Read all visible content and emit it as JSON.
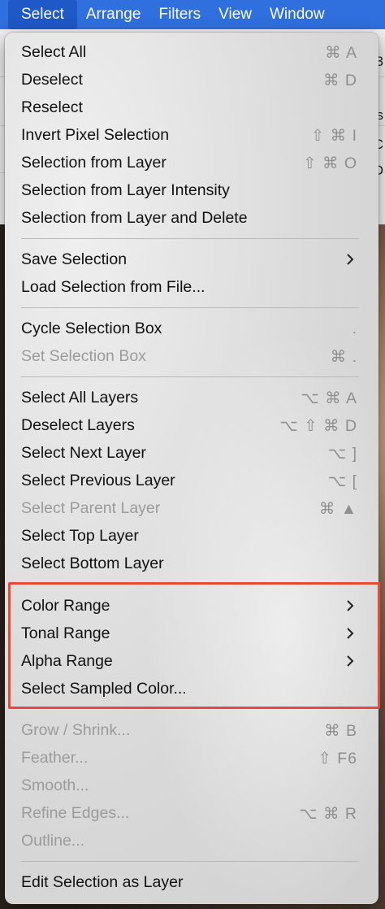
{
  "menubar": {
    "items": [
      "Select",
      "Arrange",
      "Filters",
      "View",
      "Window"
    ]
  },
  "backdrop_fragments": [
    "3",
    "s",
    "C",
    "D"
  ],
  "menu": {
    "select_all": {
      "label": "Select All",
      "shortcut": "⌘ A"
    },
    "deselect": {
      "label": "Deselect",
      "shortcut": "⌘ D"
    },
    "reselect": {
      "label": "Reselect"
    },
    "invert_pixel_selection": {
      "label": "Invert Pixel Selection",
      "shortcut": "⇧ ⌘ I"
    },
    "selection_from_layer": {
      "label": "Selection from Layer",
      "shortcut": "⇧ ⌘ O"
    },
    "selection_from_layer_intensity": {
      "label": "Selection from Layer Intensity"
    },
    "selection_from_layer_and_delete": {
      "label": "Selection from Layer and Delete"
    },
    "save_selection": {
      "label": "Save Selection"
    },
    "load_selection_from_file": {
      "label": "Load Selection from File..."
    },
    "cycle_selection_box": {
      "label": "Cycle Selection Box",
      "shortcut": "."
    },
    "set_selection_box": {
      "label": "Set Selection Box",
      "shortcut": "⌘ ."
    },
    "select_all_layers": {
      "label": "Select All Layers",
      "shortcut": "⌥ ⌘ A"
    },
    "deselect_layers": {
      "label": "Deselect Layers",
      "shortcut": "⌥ ⇧ ⌘ D"
    },
    "select_next_layer": {
      "label": "Select Next Layer",
      "shortcut": "⌥ ]"
    },
    "select_previous_layer": {
      "label": "Select Previous Layer",
      "shortcut": "⌥ ["
    },
    "select_parent_layer": {
      "label": "Select Parent Layer",
      "shortcut": "⌘ ▲"
    },
    "select_top_layer": {
      "label": "Select Top Layer"
    },
    "select_bottom_layer": {
      "label": "Select Bottom Layer"
    },
    "color_range": {
      "label": "Color Range"
    },
    "tonal_range": {
      "label": "Tonal Range"
    },
    "alpha_range": {
      "label": "Alpha Range"
    },
    "select_sampled_color": {
      "label": "Select Sampled Color..."
    },
    "grow_shrink": {
      "label": "Grow / Shrink...",
      "shortcut": "⌘ B"
    },
    "feather": {
      "label": "Feather...",
      "shortcut": "⇧ F6"
    },
    "smooth": {
      "label": "Smooth..."
    },
    "refine_edges": {
      "label": "Refine Edges...",
      "shortcut": "⌥ ⌘ R"
    },
    "outline": {
      "label": "Outline..."
    },
    "edit_selection_as_layer": {
      "label": "Edit Selection as Layer"
    }
  },
  "colors": {
    "menubar_bg": "#2f6fde",
    "highlight_border": "#e8493a",
    "disabled_text": "#9b9b9b"
  }
}
